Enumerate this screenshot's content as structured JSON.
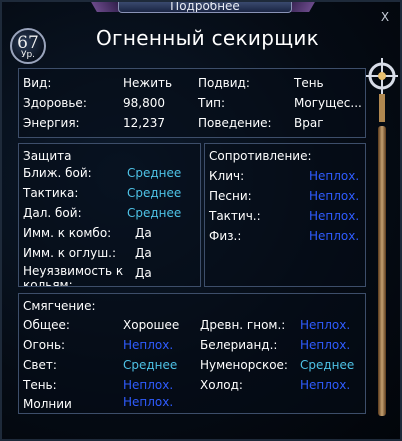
{
  "window": {
    "tab_title": "Подробнее",
    "close_label": "X",
    "level": "67",
    "level_label": "Ур.",
    "title": "Огненный секирщик"
  },
  "info": {
    "type_label": "Вид:",
    "type_value": "Нежить",
    "health_label": "Здоровье:",
    "health_value": "98,800",
    "energy_label": "Энергия:",
    "energy_value": "12,237",
    "subtype_label": "Подвид:",
    "subtype_value": "Тень",
    "class_label": "Тип:",
    "class_value": "Могущес...",
    "behavior_label": "Поведение:",
    "behavior_value": "Враг"
  },
  "defense": {
    "header": "Защита",
    "rows": [
      {
        "label": "Ближ. бой:",
        "value": "Среднее"
      },
      {
        "label": "Тактика:",
        "value": "Среднее"
      },
      {
        "label": "Дал. бой:",
        "value": "Среднее"
      },
      {
        "label": "Имм. к комбо:",
        "value": "Да"
      },
      {
        "label": "Имм. к оглуш.:",
        "value": "Да"
      },
      {
        "label": "Неуязвимость к кольям:",
        "value": "Да"
      }
    ]
  },
  "resistance": {
    "header": "Сопротивление:",
    "rows": [
      {
        "label": "Клич:",
        "value": "Неплох."
      },
      {
        "label": "Песни:",
        "value": "Неплох."
      },
      {
        "label": "Тактич.:",
        "value": "Неплох."
      },
      {
        "label": "Физ.:",
        "value": "Неплох."
      }
    ]
  },
  "mitigation": {
    "header": "Смягчение:",
    "left": [
      {
        "label": "Общее:",
        "value": "Хорошее"
      },
      {
        "label": "Огонь:",
        "value": "Неплох."
      },
      {
        "label": "Свет:",
        "value": "Среднее"
      },
      {
        "label": "Тень:",
        "value": "Неплох."
      },
      {
        "label": "Молнии",
        "value": "Неплох."
      }
    ],
    "right": [
      {
        "label": "Древн. гном.:",
        "value": "Неплох."
      },
      {
        "label": "Белерианд.:",
        "value": "Неплох."
      },
      {
        "label": "Нуменорское:",
        "value": "Среднее"
      },
      {
        "label": "Холод:",
        "value": "Неплох."
      }
    ]
  },
  "colors": {
    "text": "#ffffff",
    "value_cyan": "#4ec2e6",
    "value_blue": "#2f5cff",
    "panel_border": "#3d4e6a"
  },
  "icons": [
    "close-icon",
    "level-badge-icon",
    "scroll-ornament-icon"
  ]
}
